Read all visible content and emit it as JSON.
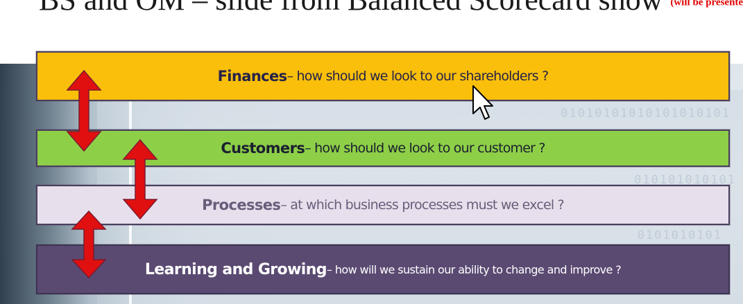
{
  "slide": {
    "title_text": "BS and OM – slide from Balanced Scorecard show",
    "title_note": "(will be presented"
  },
  "background": {
    "binary_1": "01010101010101010101",
    "binary_2": "010101010101",
    "binary_3": "0101010101"
  },
  "bars": [
    {
      "label": "Finances",
      "text": " – how should we look to our shareholders ?",
      "color": "#f9bf0a"
    },
    {
      "label": "Customers",
      "text": " – how should we look to our customer ?",
      "color": "#8ecf48"
    },
    {
      "label": "Processes",
      "text": " – at which business processes must we excel ?",
      "color": "#e7e0ec"
    },
    {
      "label": "Learning and Growing",
      "text": " – how will we sustain  our ability to change and improve ?",
      "color": "#5a4a72"
    }
  ],
  "arrows": {
    "color": "#e01010",
    "icon": "double-headed-vertical-arrow"
  },
  "cursor": {
    "icon": "mouse-pointer-arrow"
  }
}
